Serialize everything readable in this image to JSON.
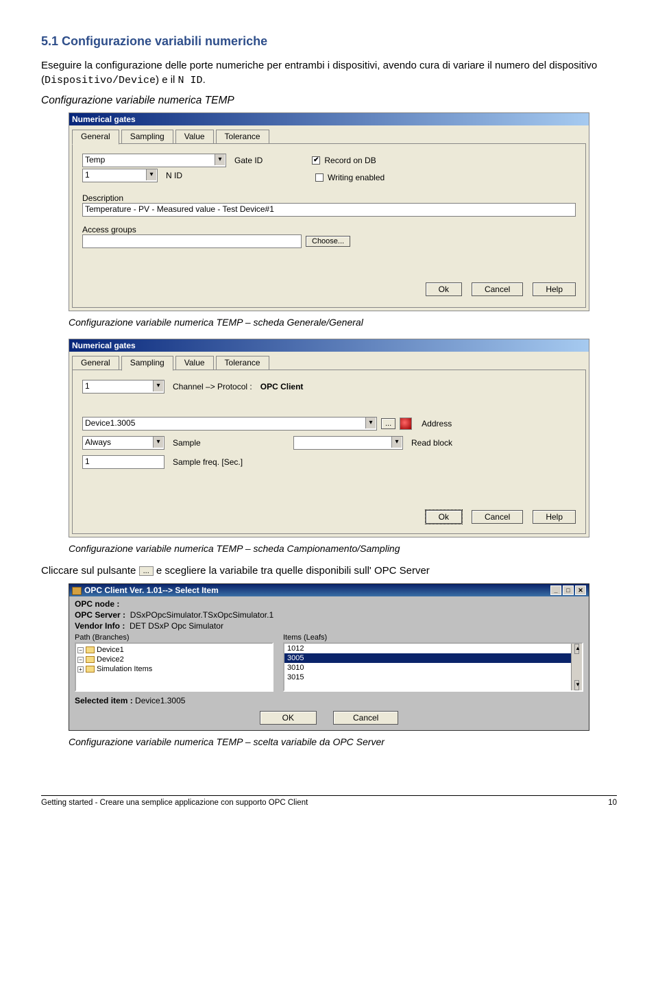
{
  "section": {
    "title": "5.1 Configurazione variabili numeriche",
    "intro_a": "Eseguire la configurazione delle porte numeriche per entrambi i dispositivi, avendo cura di variare il numero del dispositivo (",
    "intro_mono1": "Dispositivo/Device",
    "intro_b": ") e il ",
    "intro_mono2": "N ID",
    "intro_c": ".",
    "subhead": "Configurazione variabile numerica TEMP"
  },
  "dlg1": {
    "title": "Numerical gates",
    "tabs": [
      "General",
      "Sampling",
      "Value",
      "Tolerance"
    ],
    "active_tab": 0,
    "gate_dropdown": "Temp",
    "gate_id_label": "Gate ID",
    "record_db_label": "Record on DB",
    "record_db_checked": "✔",
    "writing_label": "Writing enabled",
    "writing_checked": "",
    "nid_value": "1",
    "nid_label": "N ID",
    "desc_label": "Description",
    "desc_value": "Temperature - PV - Measured value - Test Device#1",
    "access_label": "Access groups",
    "access_value": "",
    "choose_btn": "Choose...",
    "ok": "Ok",
    "cancel": "Cancel",
    "help": "Help"
  },
  "caption1": "Configurazione variabile numerica TEMP – scheda Generale/General",
  "dlg2": {
    "title": "Numerical gates",
    "tabs": [
      "General",
      "Sampling",
      "Value",
      "Tolerance"
    ],
    "active_tab": 1,
    "channel_value": "1",
    "channel_label": "Channel –> Protocol :",
    "protocol_value": "OPC Client",
    "address_value": "Device1.3005",
    "browse": "...",
    "address_label": "Address",
    "sample_value": "Always",
    "sample_label": "Sample",
    "readblock_value": "",
    "readblock_label": "Read block",
    "freq_value": "1",
    "freq_label": "Sample freq. [Sec.]",
    "ok": "Ok",
    "cancel": "Cancel",
    "help": "Help"
  },
  "caption2": "Configurazione variabile numerica TEMP – scheda Campionamento/Sampling",
  "click_para_a": "Cliccare sul pulsante ",
  "click_btn": "...",
  "click_para_b": " e scegliere la variabile tra quelle disponibili sull' OPC Server",
  "opc": {
    "title": "OPC Client  Ver. 1.01--> Select Item",
    "node_label": "OPC node   :",
    "server_label": "OPC Server :",
    "server_value": "DSxPOpcSimulator.TSxOpcSimulator.1",
    "vendor_label": "Vendor Info :",
    "vendor_value": "DET DSxP Opc Simulator",
    "path_label": "Path (Branches)",
    "items_label": "Items (Leafs)",
    "tree": [
      "Device1",
      "Device2",
      "Simulation Items"
    ],
    "tree_exp": [
      "−",
      "−",
      "+"
    ],
    "leafs": [
      "1012",
      "3005",
      "3010",
      "3015"
    ],
    "selected_leaf_index": 1,
    "selected_label": "Selected  item :",
    "selected_value": "Device1.3005",
    "ok": "OK",
    "cancel": "Cancel"
  },
  "caption3": "Configurazione variabile numerica TEMP – scelta variabile da OPC Server",
  "footer": {
    "left": "Getting started - Creare una semplice applicazione con supporto OPC Client",
    "right": "10"
  }
}
